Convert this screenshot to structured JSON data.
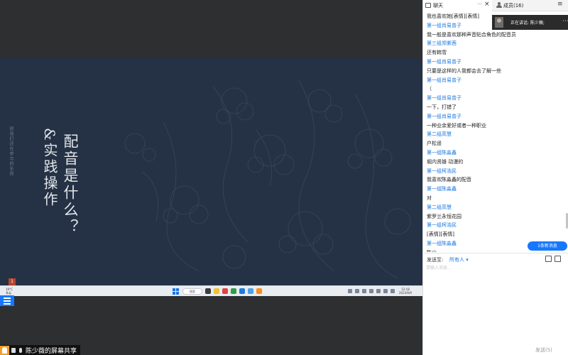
{
  "slide": {
    "title_vertical": "配音是什么？",
    "subtitle_vertical": "&实践操作",
    "side_note": "把我们还在参与的东西",
    "page_badge": "1"
  },
  "taskbar": {
    "weather": "19°C",
    "weather_sub": "多云",
    "search_label": "搜索",
    "time": "12:18",
    "date": "2023/6/9"
  },
  "share_status": {
    "label": "陈少薇的屏幕共享"
  },
  "chat_panel": {
    "tab_chat_label": "聊天",
    "tab_members_label": "成员(16)",
    "speaker_text": "正在讲话: 陈少薇;",
    "messages": [
      {
        "type": "msg",
        "text": "我也喜欢她[表情][表情]"
      },
      {
        "type": "sender",
        "text": "第一组肖易曾子"
      },
      {
        "type": "msg",
        "text": "我一般是喜欢那种声音贴合角色的配音员"
      },
      {
        "type": "sender",
        "text": "第三组郑紫茜"
      },
      {
        "type": "msg",
        "text": "还有韩雪"
      },
      {
        "type": "sender",
        "text": "第一组肖易曾子"
      },
      {
        "type": "msg",
        "text": "只要是这样的人我都会去了解一些"
      },
      {
        "type": "sender",
        "text": "第一组肖易曾子"
      },
      {
        "type": "msg",
        "text": "（"
      },
      {
        "type": "sender",
        "text": "第一组肖易曾子"
      },
      {
        "type": "msg",
        "text": "一下，打错了"
      },
      {
        "type": "sender",
        "text": "第一组肖易曾子"
      },
      {
        "type": "msg",
        "text": "一种业余爱好或者一种职业"
      },
      {
        "type": "sender",
        "text": "第二组高慧"
      },
      {
        "type": "msg",
        "text": "户松遥"
      },
      {
        "type": "sender",
        "text": "第一组陈淼鑫"
      },
      {
        "type": "msg",
        "text": "堀内贤雄 动漫的"
      },
      {
        "type": "sender",
        "text": "第一组柯浩民"
      },
      {
        "type": "msg",
        "text": "我喜欢陈淼鑫的配音"
      },
      {
        "type": "sender",
        "text": "第一组陈淼鑫"
      },
      {
        "type": "msg",
        "text": "对"
      },
      {
        "type": "sender",
        "text": "第二组高慧"
      },
      {
        "type": "msg",
        "text": "紫罗兰永恒花园"
      },
      {
        "type": "sender",
        "text": "第一组柯浩民"
      },
      {
        "type": "msg",
        "text": "[表情][表情]"
      },
      {
        "type": "sender",
        "text": "第一组陈淼鑫"
      },
      {
        "type": "msg",
        "text": "陈少"
      }
    ],
    "new_message_badge": "1条新消息",
    "send_to_label": "发送至:",
    "send_to_value": "所有人",
    "input_placeholder": "请输入消息...",
    "send_button": "发送(S)"
  }
}
